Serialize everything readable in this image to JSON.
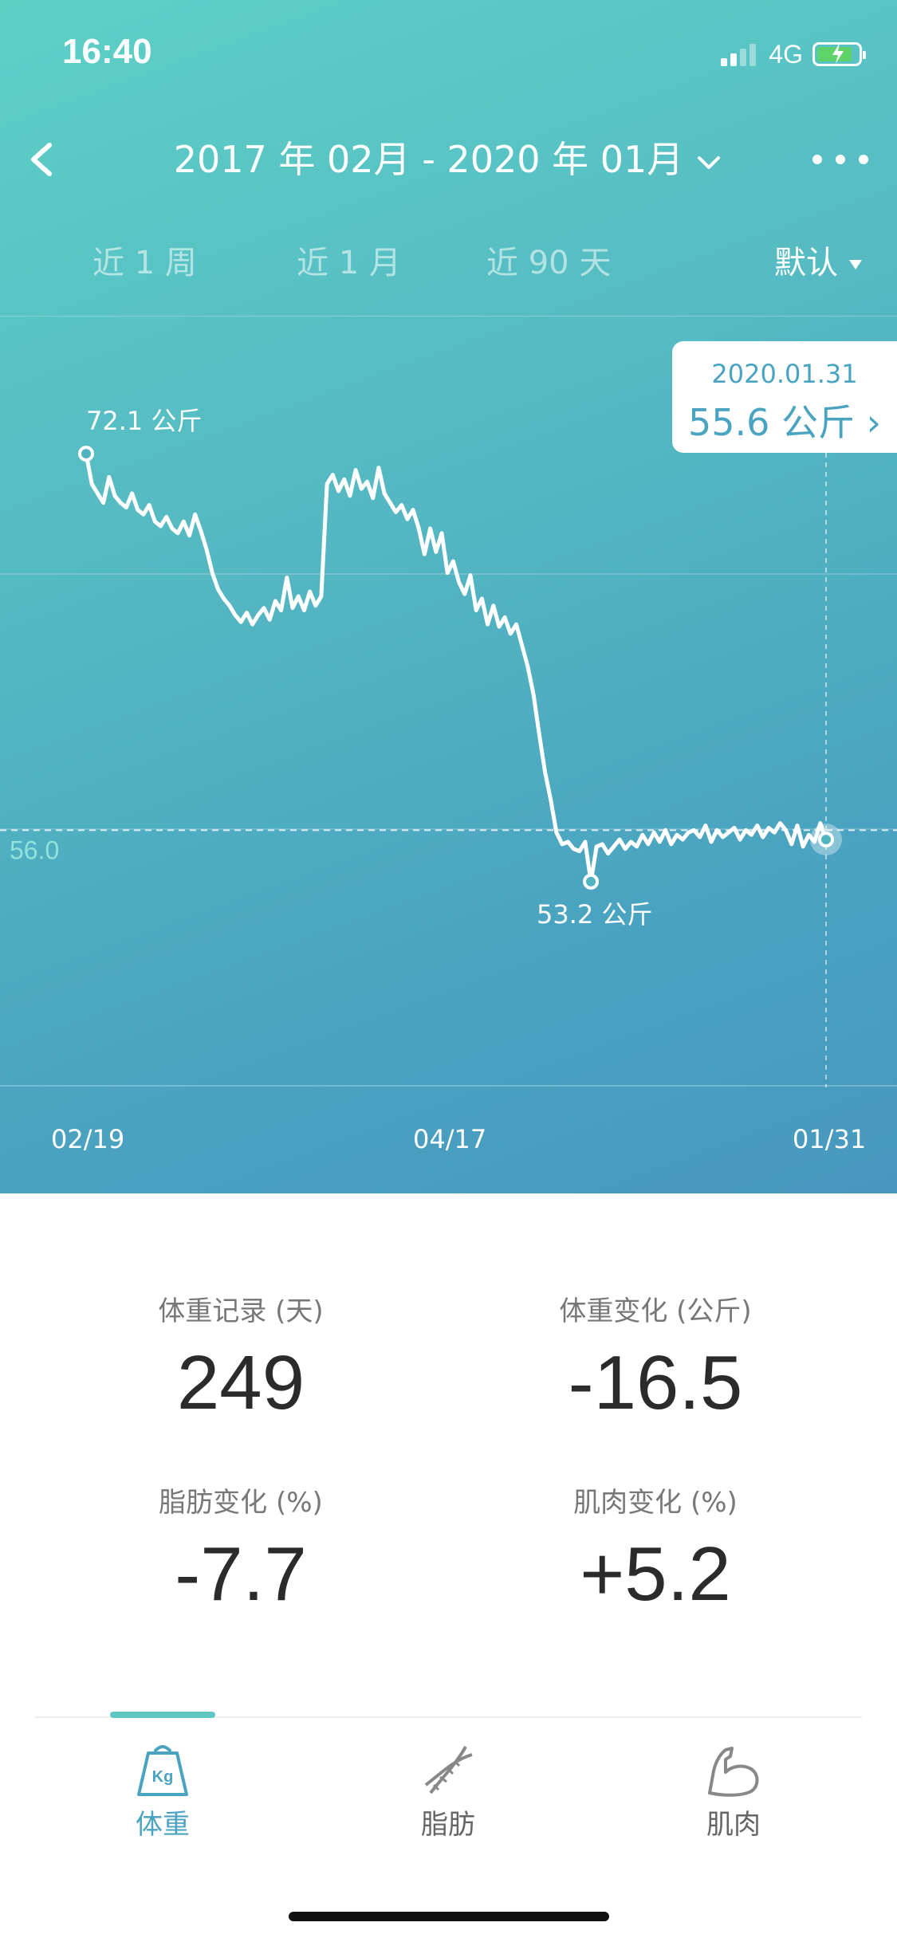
{
  "status": {
    "time": "16:40",
    "network": "4G",
    "battery_level": 0.85,
    "battery_charging": true
  },
  "nav": {
    "title": "2017 年 02月 - 2020 年 01月"
  },
  "range_tabs": [
    {
      "label": "近 1 周"
    },
    {
      "label": "近 1 月"
    },
    {
      "label": "近 90 天"
    }
  ],
  "sort": {
    "label": "默认"
  },
  "tooltip": {
    "date": "2020.01.31",
    "value": "55.6 公斤 ›"
  },
  "chart_data": {
    "type": "line",
    "title": "",
    "xlabel": "",
    "ylabel": "",
    "x_tick_labels": [
      "02/19",
      "04/17",
      "01/31"
    ],
    "reference_line": {
      "value": 56.0,
      "label": "56.0"
    },
    "annotations": [
      {
        "label": "72.1 公斤",
        "value": 72.1,
        "point": "max"
      },
      {
        "label": "53.2 公斤",
        "value": 53.2,
        "point": "min"
      }
    ],
    "ylim": [
      45,
      78
    ],
    "series": [
      {
        "values": [
          72.1,
          70.8,
          70.4,
          70.0,
          71.1,
          70.3,
          70.0,
          69.8,
          70.4,
          69.7,
          69.5,
          69.9,
          69.2,
          69.0,
          69.4,
          68.9,
          68.7,
          69.2,
          68.6,
          69.5,
          68.8,
          68.0,
          67.0,
          66.3,
          65.9,
          65.6,
          65.2,
          64.9,
          65.3,
          64.8,
          65.2,
          65.5,
          65.0,
          65.8,
          65.4,
          66.8,
          65.5,
          66.0,
          65.4,
          66.2,
          65.6,
          66.0,
          70.8,
          71.2,
          70.5,
          71.0,
          70.3,
          71.4,
          70.6,
          70.9,
          70.2,
          71.5,
          70.4,
          70.0,
          69.6,
          69.9,
          69.3,
          69.7,
          68.9,
          67.8,
          68.9,
          67.9,
          68.7,
          67.0,
          67.5,
          66.6,
          66.1,
          66.9,
          65.4,
          65.9,
          64.8,
          65.6,
          64.7,
          65.1,
          64.4,
          64.8,
          63.9,
          63.0,
          61.8,
          60.1,
          58.5,
          57.3,
          55.9,
          55.4,
          55.5,
          55.2,
          55.1,
          55.5,
          53.8,
          55.3,
          55.4,
          55.0,
          55.3,
          55.6,
          55.2,
          55.5,
          55.3,
          55.8,
          55.4,
          55.9,
          55.5,
          56.0,
          55.4,
          55.8,
          55.6,
          55.9,
          56.0,
          55.7,
          56.2,
          55.5,
          56.0,
          55.7,
          55.9,
          56.1,
          55.6,
          56.0,
          55.8,
          56.2,
          55.7,
          56.1,
          55.9,
          56.3,
          56.0,
          55.4,
          56.2,
          55.3,
          55.8,
          55.5,
          56.3,
          55.6
        ]
      }
    ],
    "selected_point": {
      "date": "2020.01.31",
      "value": 55.6
    }
  },
  "stats": [
    {
      "label": "体重记录 (天)",
      "value": "249"
    },
    {
      "label": "体重变化 (公斤)",
      "value": "-16.5"
    },
    {
      "label": "脂肪变化 (%)",
      "value": "-7.7"
    },
    {
      "label": "肌肉变化 (%)",
      "value": "+5.2"
    }
  ],
  "tabbar": {
    "tabs": [
      {
        "label": "体重",
        "icon": "weight-kg-icon",
        "active": true
      },
      {
        "label": "脂肪",
        "icon": "dna-icon",
        "active": false
      },
      {
        "label": "肌肉",
        "icon": "muscle-arm-icon",
        "active": false
      }
    ],
    "kg_icon_text": "Kg"
  },
  "colors": {
    "accent": "#4aa3c0",
    "indicator": "#5fc6c3",
    "gradient_start": "#5dd0c6",
    "gradient_end": "#4798bf"
  }
}
